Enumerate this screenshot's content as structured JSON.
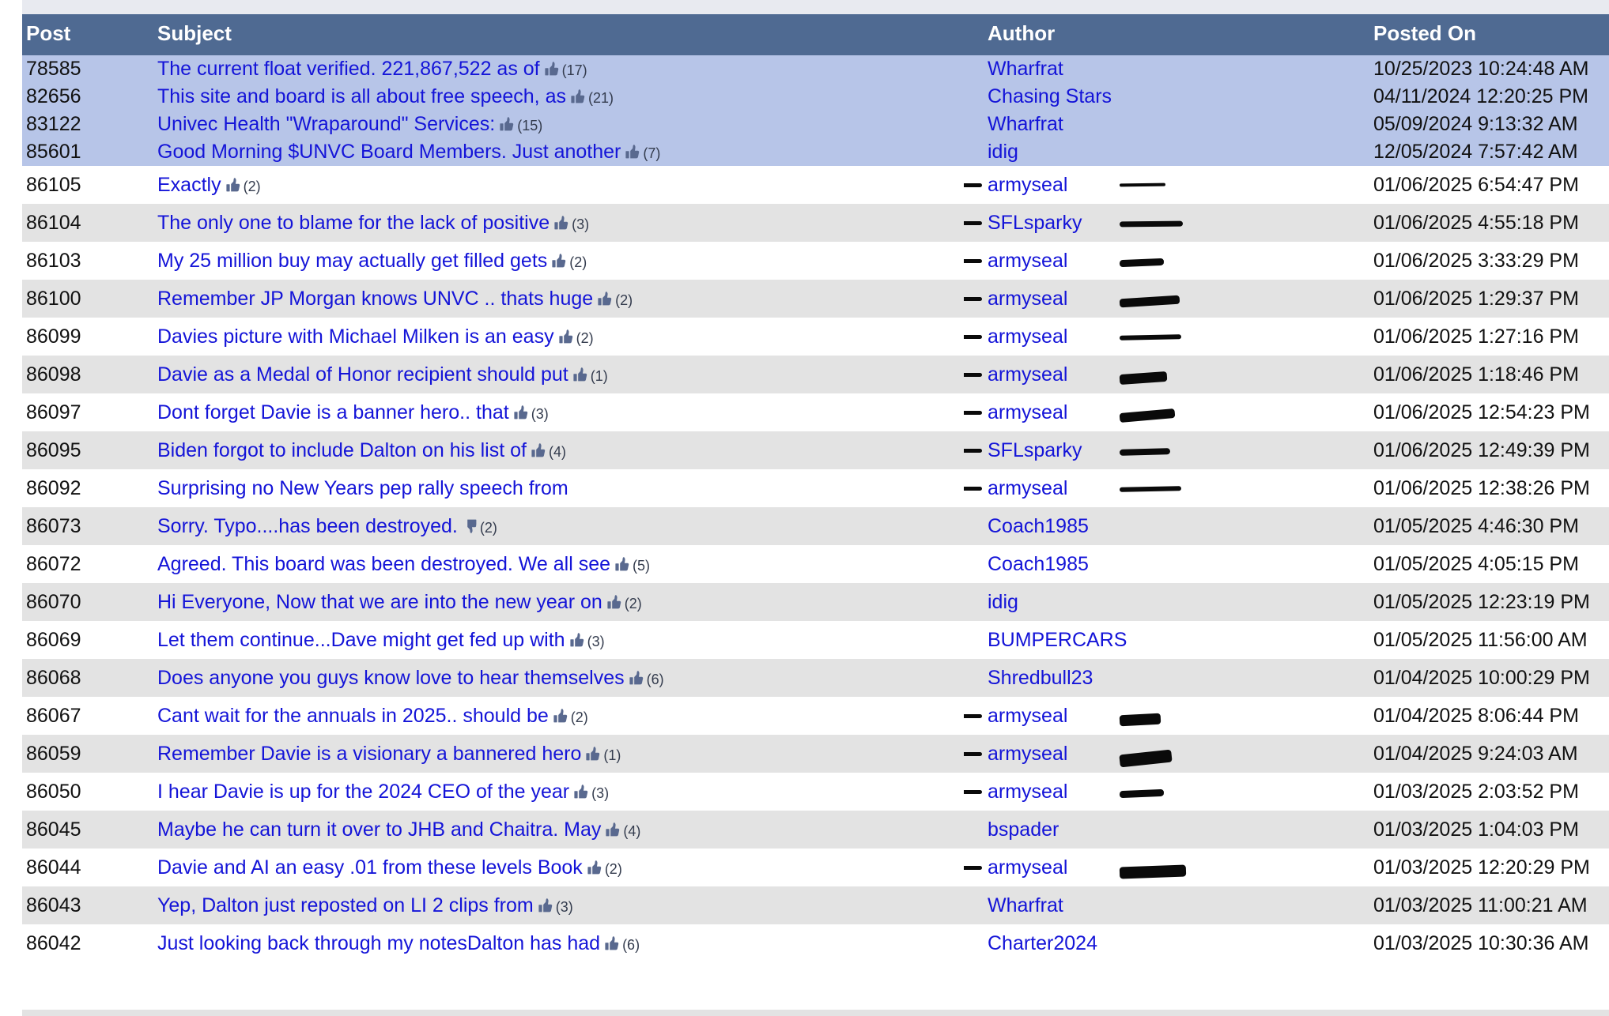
{
  "table": {
    "columns": [
      {
        "key": "post",
        "label": "Post"
      },
      {
        "key": "subject",
        "label": "Subject"
      },
      {
        "key": "author",
        "label": "Author"
      },
      {
        "key": "date",
        "label": "Posted On"
      }
    ],
    "header_bg": "#4f6a92",
    "sticky_row_bg": "#b7c5e8",
    "alt_row_bg": "#e3e3e3",
    "link_color": "#1414d8",
    "rows": [
      {
        "post": "78585",
        "subject": "The current float verified. 221,867,522 as of",
        "reaction": "thumbs-up",
        "reaction_count": "(17)",
        "author": "Wharfrat",
        "date": "10/25/2023 10:24:48 AM",
        "sticky": true,
        "redacted": false
      },
      {
        "post": "82656",
        "subject": "This site and board is all about free speech, as",
        "reaction": "thumbs-up",
        "reaction_count": "(21)",
        "author": "Chasing Stars",
        "date": "04/11/2024 12:20:25 PM",
        "sticky": true,
        "redacted": false
      },
      {
        "post": "83122",
        "subject": "Univec Health \"Wraparound\" Services:",
        "reaction": "thumbs-up",
        "reaction_count": "(15)",
        "author": "Wharfrat",
        "date": "05/09/2024 9:13:32 AM",
        "sticky": true,
        "redacted": false
      },
      {
        "post": "85601",
        "subject": "Good Morning $UNVC Board Members. Just another",
        "reaction": "thumbs-up",
        "reaction_count": "(7)",
        "author": "idig",
        "date": "12/05/2024 7:57:42 AM",
        "sticky": true,
        "redacted": false
      },
      {
        "post": "86105",
        "subject": "Exactly",
        "reaction": "thumbs-up",
        "reaction_count": "(2)",
        "author": "armyseal",
        "date": "01/06/2025 6:54:47 PM",
        "sticky": false,
        "redacted": true,
        "redact_style": "r-w1"
      },
      {
        "post": "86104",
        "subject": "The only one to blame for the lack of positive",
        "reaction": "thumbs-up",
        "reaction_count": "(3)",
        "author": "SFLsparky",
        "date": "01/06/2025 4:55:18 PM",
        "sticky": false,
        "redacted": true,
        "redact_style": "r-w2"
      },
      {
        "post": "86103",
        "subject": "My 25 million buy may actually get filled gets",
        "reaction": "thumbs-up",
        "reaction_count": "(2)",
        "author": "armyseal",
        "date": "01/06/2025 3:33:29 PM",
        "sticky": false,
        "redacted": true,
        "redact_style": "r-w3"
      },
      {
        "post": "86100",
        "subject": "Remember JP Morgan knows UNVC .. thats huge",
        "reaction": "thumbs-up",
        "reaction_count": "(2)",
        "author": "armyseal",
        "date": "01/06/2025 1:29:37 PM",
        "sticky": false,
        "redacted": true,
        "redact_style": "r-w4"
      },
      {
        "post": "86099",
        "subject": "Davies picture with Michael Milken is an easy",
        "reaction": "thumbs-up",
        "reaction_count": "(2)",
        "author": "armyseal",
        "date": "01/06/2025 1:27:16 PM",
        "sticky": false,
        "redacted": true,
        "redact_style": "r-w5"
      },
      {
        "post": "86098",
        "subject": "Davie as a Medal of Honor recipient should put",
        "reaction": "thumbs-up",
        "reaction_count": "(1)",
        "author": "armyseal",
        "date": "01/06/2025 1:18:46 PM",
        "sticky": false,
        "redacted": true,
        "redact_style": "r-w6"
      },
      {
        "post": "86097",
        "subject": "Dont forget Davie is a banner hero.. that",
        "reaction": "thumbs-up",
        "reaction_count": "(3)",
        "author": "armyseal",
        "date": "01/06/2025 12:54:23 PM",
        "sticky": false,
        "redacted": true,
        "redact_style": "r-w7"
      },
      {
        "post": "86095",
        "subject": "Biden forgot to include Dalton on his list of",
        "reaction": "thumbs-up",
        "reaction_count": "(4)",
        "author": "SFLsparky",
        "date": "01/06/2025 12:49:39 PM",
        "sticky": false,
        "redacted": true,
        "redact_style": "r-w8"
      },
      {
        "post": "86092",
        "subject": "Surprising no New Years pep rally speech from",
        "reaction": "none",
        "reaction_count": "",
        "author": "armyseal",
        "date": "01/06/2025 12:38:26 PM",
        "sticky": false,
        "redacted": true,
        "redact_style": "r-w5"
      },
      {
        "post": "86073",
        "subject": "Sorry. Typo....has been destroyed.",
        "reaction": "thumbs-down",
        "reaction_count": "(2)",
        "author": "Coach1985",
        "date": "01/05/2025 4:46:30 PM",
        "sticky": false,
        "redacted": false
      },
      {
        "post": "86072",
        "subject": "Agreed. This board was been destroyed. We all see",
        "reaction": "thumbs-up",
        "reaction_count": "(5)",
        "author": "Coach1985",
        "date": "01/05/2025 4:05:15 PM",
        "sticky": false,
        "redacted": false
      },
      {
        "post": "86070",
        "subject": "Hi Everyone, Now that we are into the new year on",
        "reaction": "thumbs-up",
        "reaction_count": "(2)",
        "author": "idig",
        "date": "01/05/2025 12:23:19 PM",
        "sticky": false,
        "redacted": false
      },
      {
        "post": "86069",
        "subject": "Let them continue...Dave might get fed up with",
        "reaction": "thumbs-up",
        "reaction_count": "(3)",
        "author": "BUMPERCARS",
        "date": "01/05/2025 11:56:00 AM",
        "sticky": false,
        "redacted": false
      },
      {
        "post": "86068",
        "subject": "Does anyone you guys know love to hear themselves",
        "reaction": "thumbs-up",
        "reaction_count": "(6)",
        "author": "Shredbull23",
        "date": "01/04/2025 10:00:29 PM",
        "sticky": false,
        "redacted": false
      },
      {
        "post": "86067",
        "subject": "Cant wait for the annuals in 2025.. should be",
        "reaction": "thumbs-up",
        "reaction_count": "(2)",
        "author": "armyseal",
        "date": "01/04/2025 8:06:44 PM",
        "sticky": false,
        "redacted": true,
        "redact_style": "r-w9"
      },
      {
        "post": "86059",
        "subject": "Remember Davie is a visionary a bannered hero",
        "reaction": "thumbs-up",
        "reaction_count": "(1)",
        "author": "armyseal",
        "date": "01/04/2025 9:24:03 AM",
        "sticky": false,
        "redacted": true,
        "redact_style": "r-w10"
      },
      {
        "post": "86050",
        "subject": "I hear Davie is up for the 2024 CEO of the year",
        "reaction": "thumbs-up",
        "reaction_count": "(3)",
        "author": "armyseal",
        "date": "01/03/2025 2:03:52 PM",
        "sticky": false,
        "redacted": true,
        "redact_style": "r-w3"
      },
      {
        "post": "86045",
        "subject": "Maybe he can turn it over to JHB and Chaitra. May",
        "reaction": "thumbs-up",
        "reaction_count": "(4)",
        "author": "bspader",
        "date": "01/03/2025 1:04:03 PM",
        "sticky": false,
        "redacted": false
      },
      {
        "post": "86044",
        "subject": "Davie and AI an easy .01 from these levels Book",
        "reaction": "thumbs-up",
        "reaction_count": "(2)",
        "author": "armyseal",
        "date": "01/03/2025 12:20:29 PM",
        "sticky": false,
        "redacted": true,
        "redact_style": "r-w11"
      },
      {
        "post": "86043",
        "subject": "Yep, Dalton just reposted on LI 2 clips from",
        "reaction": "thumbs-up",
        "reaction_count": "(3)",
        "author": "Wharfrat",
        "date": "01/03/2025 11:00:21 AM",
        "sticky": false,
        "redacted": false
      },
      {
        "post": "86042",
        "subject": "Just looking back through my notesDalton has had",
        "reaction": "thumbs-up",
        "reaction_count": "(6)",
        "author": "Charter2024",
        "date": "01/03/2025 10:30:36 AM",
        "sticky": false,
        "redacted": false
      }
    ]
  }
}
